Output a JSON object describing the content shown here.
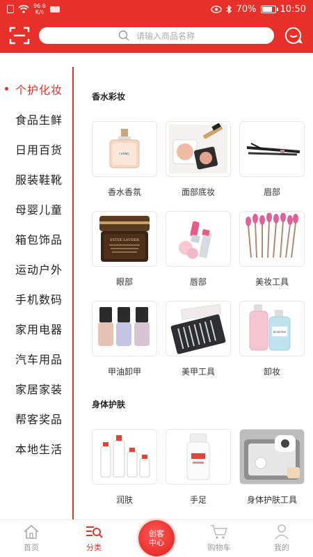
{
  "status_bar": {
    "network_speed": "96.6\nK/s",
    "battery": "70%",
    "time": "10:50"
  },
  "header": {
    "search_placeholder": "请输入商品名称"
  },
  "sidebar": {
    "items": [
      {
        "label": "个护化妆",
        "active": true
      },
      {
        "label": "食品生鲜"
      },
      {
        "label": "日用百货"
      },
      {
        "label": "服装鞋靴"
      },
      {
        "label": "母婴儿童"
      },
      {
        "label": "箱包饰品"
      },
      {
        "label": "运动户外"
      },
      {
        "label": "手机数码"
      },
      {
        "label": "家用电器"
      },
      {
        "label": "汽车用品"
      },
      {
        "label": "家居家装"
      },
      {
        "label": "帮客奖品"
      },
      {
        "label": "本地生活"
      }
    ]
  },
  "sections": [
    {
      "title": "香水彩妆",
      "items": [
        {
          "label": "香水香氛",
          "image_text": "CHANEL"
        },
        {
          "label": "面部底妆"
        },
        {
          "label": "眉部"
        },
        {
          "label": "眼部",
          "image_text": "ESTEE LAUDER"
        },
        {
          "label": "唇部"
        },
        {
          "label": "美妆工具"
        },
        {
          "label": "甲油卸甲"
        },
        {
          "label": "美甲工具"
        },
        {
          "label": "卸妆",
          "image_text": "BIODERMA"
        }
      ]
    },
    {
      "title": "身体护肤",
      "items": [
        {
          "label": "润肤"
        },
        {
          "label": "手足"
        },
        {
          "label": "身体护肤工具"
        }
      ]
    }
  ],
  "bottom_nav": {
    "home": "首页",
    "category": "分类",
    "center": "创客\n中心",
    "cart": "购物车",
    "mine": "我的"
  },
  "colors": {
    "brand_red": "#e8302a"
  }
}
